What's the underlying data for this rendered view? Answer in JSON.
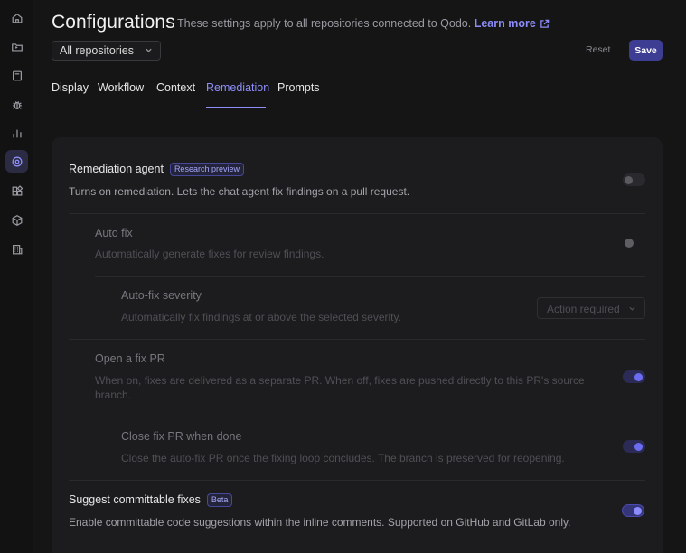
{
  "sidebar": {
    "items": [
      {
        "icon": "home-icon",
        "active": false
      },
      {
        "icon": "folder-icon",
        "active": false
      },
      {
        "icon": "book-icon",
        "active": false
      },
      {
        "icon": "bug-icon",
        "active": false
      },
      {
        "icon": "chart-icon",
        "active": false
      },
      {
        "icon": "settings-icon",
        "active": true
      },
      {
        "icon": "integrations-icon",
        "active": false
      },
      {
        "icon": "package-icon",
        "active": false
      },
      {
        "icon": "building-icon",
        "active": false
      }
    ]
  },
  "header": {
    "title": "Configurations",
    "subtitle": "These settings apply to all repositories connected to Qodo.",
    "learn_more": "Learn more"
  },
  "repo_select": {
    "value": "All repositories"
  },
  "actions": {
    "reset": "Reset",
    "save": "Save"
  },
  "tabs": [
    {
      "label": "Display",
      "active": false
    },
    {
      "label": "Workflow",
      "active": false
    },
    {
      "label": "Context",
      "active": false
    },
    {
      "label": "Remediation",
      "active": true
    },
    {
      "label": "Prompts",
      "active": false
    }
  ],
  "settings": {
    "remediation_agent": {
      "title": "Remediation agent",
      "badge": "Research preview",
      "desc": "Turns on remediation. Lets the chat agent fix findings on a pull request.",
      "enabled": false
    },
    "auto_fix": {
      "title": "Auto fix",
      "desc": "Automatically generate fixes for review findings.",
      "enabled": false
    },
    "auto_fix_severity": {
      "title": "Auto-fix severity",
      "desc": "Automatically fix findings at or above the selected severity.",
      "value": "Action required"
    },
    "open_fix_pr": {
      "title": "Open a fix PR",
      "desc_line1": "When on, fixes are delivered as a separate PR. When off, fixes are pushed directly to this PR's source",
      "desc_line2": "branch.",
      "enabled": true
    },
    "close_fix_pr": {
      "title": "Close fix PR when done",
      "desc": "Close the auto-fix PR once the fixing loop concludes. The branch is preserved for reopening.",
      "enabled": true
    },
    "suggest_committable": {
      "title": "Suggest committable fixes",
      "badge": "Beta",
      "desc": "Enable committable code suggestions within the inline comments. Supported on GitHub and GitLab only.",
      "enabled": true
    }
  },
  "colors": {
    "accent": "#8d8ef9",
    "save_bg": "#3e3d94",
    "background": "#151516",
    "card": "#1c1c1e"
  }
}
